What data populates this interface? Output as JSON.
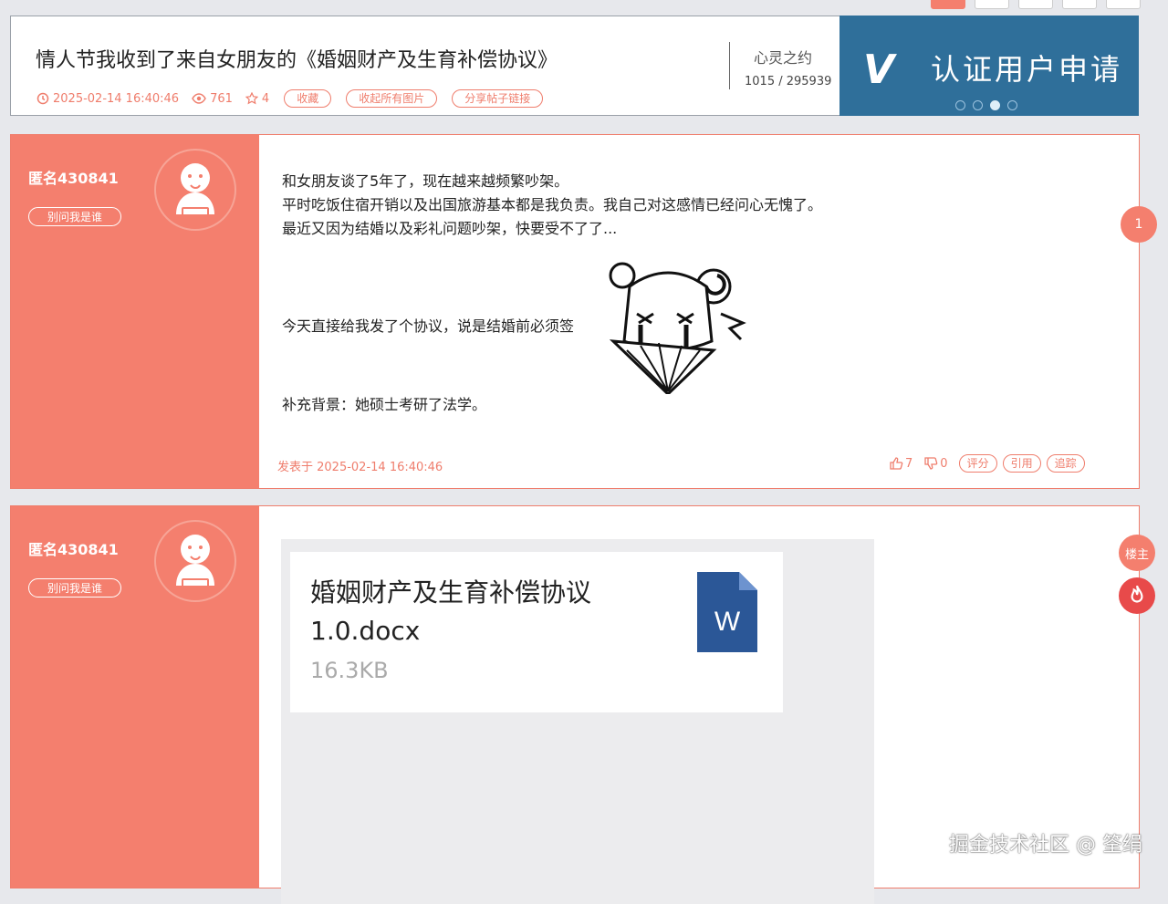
{
  "header": {
    "title": "情人节我收到了来自女朋友的《婚姻财产及生育补偿协议》",
    "datetime": "2025-02-14 16:40:46",
    "views": "761",
    "favorites": "4",
    "buttons": [
      "收藏",
      "收起所有图片",
      "分享帖子链接"
    ],
    "forum_name": "心灵之约",
    "forum_stats": "1015 / 295939"
  },
  "banner": {
    "logo_letter": "V",
    "text": "认证用户申请",
    "active_dot": 2,
    "dot_count": 4
  },
  "post1": {
    "username": "匿名430841",
    "user_tag": "别问我是谁",
    "lines": [
      "和女朋友谈了5年了，现在越来越频繁吵架。",
      "平时吃饭住宿开销以及出国旅游基本都是我负责。我自己对这感情已经问心无愧了。",
      "最近又因为结婚以及彩礼问题吵架，快要受不了了..."
    ],
    "line_sign": "今天直接给我发了个协议，说是结婚前必须签",
    "line_background": "补充背景：她硕士考研了法学。",
    "posted_at": "发表于 2025-02-14 16:40:46",
    "likes": "7",
    "dislikes": "0",
    "actions": [
      "评分",
      "引用",
      "追踪"
    ],
    "floor_badge": "1"
  },
  "post2": {
    "username": "匿名430841",
    "user_tag": "别问我是谁",
    "attachment_name": "婚姻财产及生育补偿协议1.0.docx",
    "attachment_size": "16.3KB",
    "attachment_icon_letter": "W",
    "owner_badge": "楼主"
  },
  "watermark": "掘金技术社区 @ 筌绢",
  "colors": {
    "accent": "#f47f6e",
    "banner": "#2f6f9a",
    "word_blue": "#2b5797",
    "hot": "#e84a4a"
  }
}
